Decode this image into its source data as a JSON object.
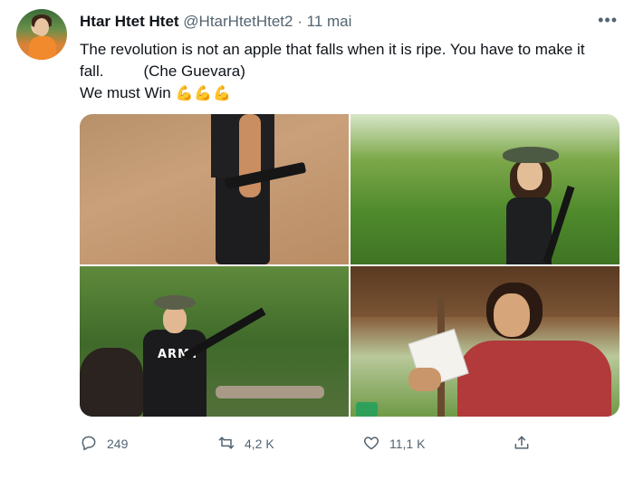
{
  "author": {
    "display_name": "Htar Htet Htet",
    "handle": "@HtarHtetHtet2",
    "separator": "·",
    "date": "11 mai"
  },
  "more_label": "•••",
  "tweet": {
    "line1": "The revolution is not an apple that falls when it is ripe. You have to make it",
    "line2": "fall.",
    "attribution": "(Che Guevara)",
    "line3": "We must Win",
    "emojis": "💪💪💪"
  },
  "media": {
    "photo3_shirt_text": "ARMY"
  },
  "actions": {
    "reply_count": "249",
    "retweet_count": "4,2 K",
    "like_count": "11,1 K"
  },
  "icons": {
    "more": "ellipsis-icon",
    "reply": "reply-icon",
    "retweet": "retweet-icon",
    "like": "heart-icon",
    "share": "share-icon"
  },
  "colors": {
    "text_primary": "#0f1419",
    "text_secondary": "#536471",
    "emoji": "#f5b400"
  }
}
